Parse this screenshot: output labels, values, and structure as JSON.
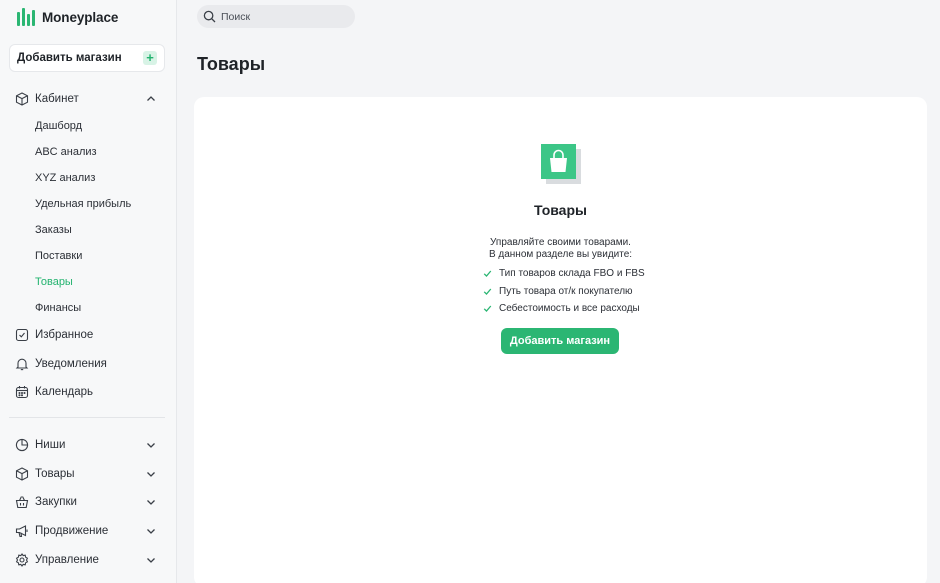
{
  "app": {
    "name": "Moneyplace"
  },
  "sidebar": {
    "add_store_label": "Добавить магазин",
    "cabinet": {
      "label": "Кабинет",
      "items": [
        "Дашборд",
        "ABC анализ",
        "XYZ анализ",
        "Удельная прибыль",
        "Заказы",
        "Поставки",
        "Товары",
        "Финансы"
      ],
      "active": "Товары"
    },
    "favorites_label": "Избранное",
    "notifications_label": "Уведомления",
    "calendar_label": "Календарь",
    "sections": [
      "Ниши",
      "Товары",
      "Закупки",
      "Продвижение",
      "Управление"
    ]
  },
  "search": {
    "placeholder": "Поиск"
  },
  "page": {
    "title": "Товары"
  },
  "empty_state": {
    "title": "Товары",
    "desc_line1": "Управляйте своими товарами.",
    "desc_line2": "В данном разделе вы увидите:",
    "features": [
      "Тип товаров склада FBO и FBS",
      "Путь товара от/к покупателю",
      "Себестоимость и все расходы"
    ],
    "button_label": "Добавить магазин"
  },
  "colors": {
    "accent": "#2bb673",
    "accent_light": "#d8f3e6"
  }
}
